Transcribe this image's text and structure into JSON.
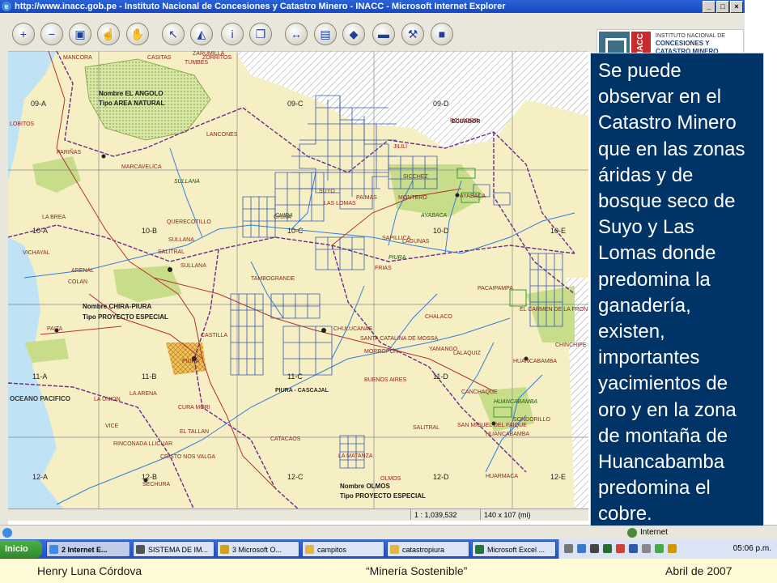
{
  "window": {
    "title": "http://www.inacc.gob.pe - Instituto Nacional de Concesiones y Catastro Minero - INACC - Microsoft Internet Explorer",
    "buttons": [
      "_",
      "□",
      "×"
    ]
  },
  "toolbar": {
    "tools": [
      {
        "icon": "zoom-in-icon",
        "glyph": "+"
      },
      {
        "icon": "zoom-out-icon",
        "glyph": "−"
      },
      {
        "icon": "zoom-box-icon",
        "glyph": "▣"
      },
      {
        "icon": "identify-hand-icon",
        "glyph": "☝"
      },
      {
        "icon": "pan-hand-icon",
        "glyph": "✋"
      },
      {
        "icon": "select-arrow-icon",
        "glyph": "↖"
      },
      {
        "icon": "eraser-icon",
        "glyph": "◭"
      },
      {
        "icon": "info-icon",
        "glyph": "i"
      },
      {
        "icon": "document-icon",
        "glyph": "❐"
      },
      {
        "icon": "full-extent-icon",
        "glyph": "↔"
      },
      {
        "icon": "save-icon",
        "glyph": "▤"
      },
      {
        "icon": "layers-icon",
        "glyph": "◆"
      },
      {
        "icon": "print-icon",
        "glyph": "▬"
      },
      {
        "icon": "tools-icon",
        "glyph": "⚒"
      },
      {
        "icon": "help-book-icon",
        "glyph": "■"
      }
    ],
    "logo": {
      "abbr": "INACC",
      "name_line1": "INSTITUTO NACIONAL DE",
      "name_line2": "CONCESIONES Y",
      "name_line3": "CATASTRO MINERO"
    }
  },
  "map": {
    "quadrants": [
      "09-A",
      "09-C",
      "09-D",
      "10-A",
      "10-B",
      "10-C",
      "10-D",
      "10-E",
      "11-A",
      "11-B",
      "11-C",
      "11-D",
      "12-A",
      "12-B",
      "12-C",
      "12-D",
      "12-E"
    ],
    "places": [
      "MANCORA",
      "CASITAS",
      "TUMBES",
      "ZARUMILLA",
      "LOBITOS",
      "PARIÑAS",
      "MARCAVELICA",
      "QUERECOTILLO",
      "LANCONES",
      "SULLANA",
      "SALITRAL",
      "CHIRA",
      "SULLANA",
      "LA BREA",
      "VICHAYAL",
      "ARENAL",
      "COLAN",
      "PAITA",
      "TAMBOGRANDE",
      "CASTILLA",
      "PIURA",
      "CHULUCANAS",
      "MORROPON",
      "SANTA CATALINA DE MOSSA",
      "BUENOS AIRES",
      "LA UNION",
      "LA ARENA",
      "CURA MORI",
      "VICE",
      "EL TALLAN",
      "RINCONADA LLICUAR",
      "CRISTO NOS VALGA",
      "SECHURA",
      "CATACAOS",
      "LA MATANZA",
      "SALITRAL",
      "CHALACO",
      "YAMANGO",
      "LALAQUIZ",
      "CANCHAQUE",
      "SAN MIGUEL DEL FAIQUE",
      "HUANCABAMBA",
      "SONDORILLO",
      "HUARMACA",
      "PACAIPAMPA",
      "AYABACA",
      "MONTERO",
      "SUYO",
      "LAS LOMAS",
      "PAIMAS",
      "SICCHEZ",
      "JILILI",
      "SAPILLICA",
      "LAGUNAS",
      "FRIAS",
      "EL CARMEN DE LA FRONTERA",
      "CHINCHIPE",
      "OLMOS",
      "HUANCABAMBA",
      "ECUADOR",
      "ZORRITOS"
    ],
    "natural_areas": [
      "SULLANA",
      "CHIRA",
      "PIURA",
      "AYABACA",
      "HUANCABAMBA"
    ],
    "boxes": [
      {
        "line1": "Nombre  EL ANGOLO",
        "line2": "Tipo  AREA NATURAL"
      },
      {
        "line1": "Nombre  CHIRA-PIURA",
        "line2": "Tipo  PROYECTO ESPECIAL"
      },
      {
        "line1": "Nombre  OLMOS",
        "line2": "Tipo  PROYECTO ESPECIAL"
      }
    ],
    "ocean_label": "OCEANO PACIFICO",
    "special_label": "PIURA - CASCAJAL",
    "country_label": "ECUADOR"
  },
  "scale_bar": {
    "scale": "1 : 1,039,532",
    "size": "140 x 107 (mi)"
  },
  "statusbar": {
    "zone": "Internet"
  },
  "taskbar": {
    "start": "Inicio",
    "tasks": [
      "2 Internet E...",
      "SISTEMA DE IM...",
      "3 Microsoft O...",
      "campitos",
      "catastropiura",
      "Microsoft Excel ..."
    ],
    "clock": "05:06 p.m."
  },
  "footer": {
    "author": "Henry Luna Córdova",
    "theme": "“Minería Sostenible”",
    "date": "Abril de 2007"
  },
  "note": {
    "text": "Se puede observar en el Catastro Minero que en las zonas áridas y de bosque seco de Suyo y Las Lomas donde predomina la ganadería, existen, importantes yacimientos de oro y en la zona de montaña de Huancabamba predomina el cobre."
  },
  "colors": {
    "map_land": "#f7efc4",
    "ocean": "#bfe3f5",
    "river": "#2f7fd8",
    "concession": "#2f57b0",
    "natural_area": "#c8dd8a",
    "note_bg": "#003366",
    "footer_bg": "#fffbd6"
  }
}
